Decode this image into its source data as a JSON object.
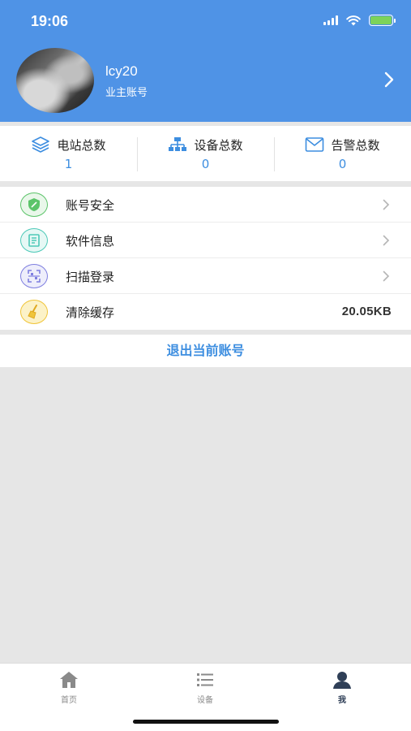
{
  "status_bar": {
    "time": "19:06"
  },
  "profile": {
    "username": "lcy20",
    "role": "业主账号"
  },
  "stats": [
    {
      "icon": "layers-icon",
      "label": "电站总数",
      "value": "1"
    },
    {
      "icon": "network-icon",
      "label": "设备总数",
      "value": "0"
    },
    {
      "icon": "mail-icon",
      "label": "告警总数",
      "value": "0"
    }
  ],
  "menu": [
    {
      "icon": "shield-icon",
      "label": "账号安全",
      "color": "#5cc46a"
    },
    {
      "icon": "document-icon",
      "label": "软件信息",
      "color": "#4ec9b8"
    },
    {
      "icon": "scan-icon",
      "label": "扫描登录",
      "color": "#7f7fe0"
    },
    {
      "icon": "broom-icon",
      "label": "清除缓存",
      "color": "#f0c53a",
      "value": "20.05KB"
    }
  ],
  "logout_label": "退出当前账号",
  "tabs": [
    {
      "icon": "home-icon",
      "label": "首页"
    },
    {
      "icon": "list-icon",
      "label": "设备"
    },
    {
      "icon": "user-icon",
      "label": "我"
    }
  ],
  "colors": {
    "header": "#4f93e6",
    "accent": "#3d8ee0",
    "background": "#e6e6e6"
  }
}
